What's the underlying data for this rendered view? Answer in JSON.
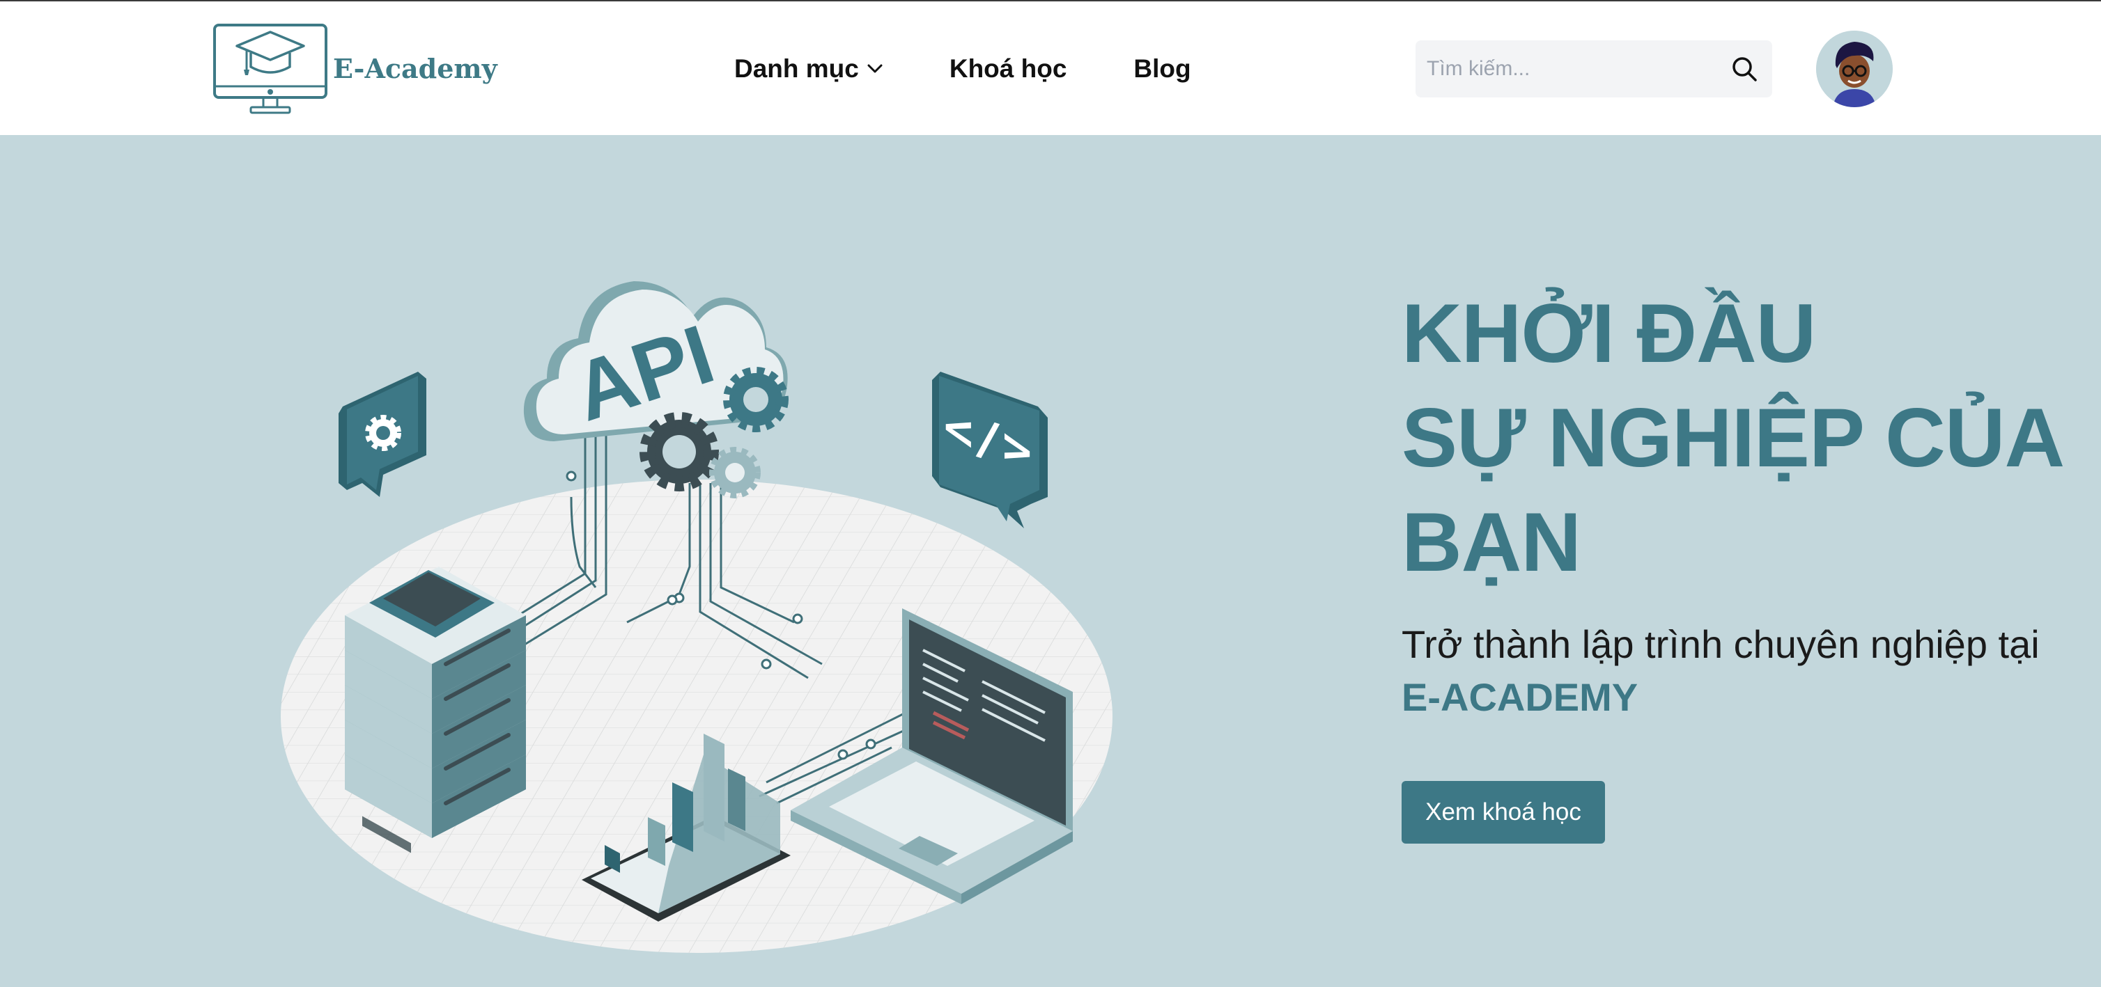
{
  "header": {
    "logo_text": "E-Academy",
    "nav": [
      {
        "label": "Danh mục",
        "has_dropdown": true
      },
      {
        "label": "Khoá học"
      },
      {
        "label": "Blog"
      }
    ],
    "search": {
      "placeholder": "Tìm kiếm..."
    }
  },
  "hero": {
    "headline_lines": [
      "KHỞI ĐẦU",
      "SỰ NGHIỆP CỦA",
      "BẠN"
    ],
    "subline_part1": "Trở thành lập trình chuyên nghiệp tại",
    "subline_brand": "E-ACADEMY",
    "cta_label": "Xem khoá học",
    "illustration_cloud_text": "API"
  },
  "colors": {
    "accent": "#3d7886",
    "hero_bg": "#c3d7dc",
    "header_bg": "#ffffff",
    "search_bg": "#f3f4f6"
  },
  "icons": [
    "graduation-cap-monitor-icon",
    "chevron-down-icon",
    "search-icon",
    "user-avatar",
    "gear-icon",
    "code-icon"
  ]
}
